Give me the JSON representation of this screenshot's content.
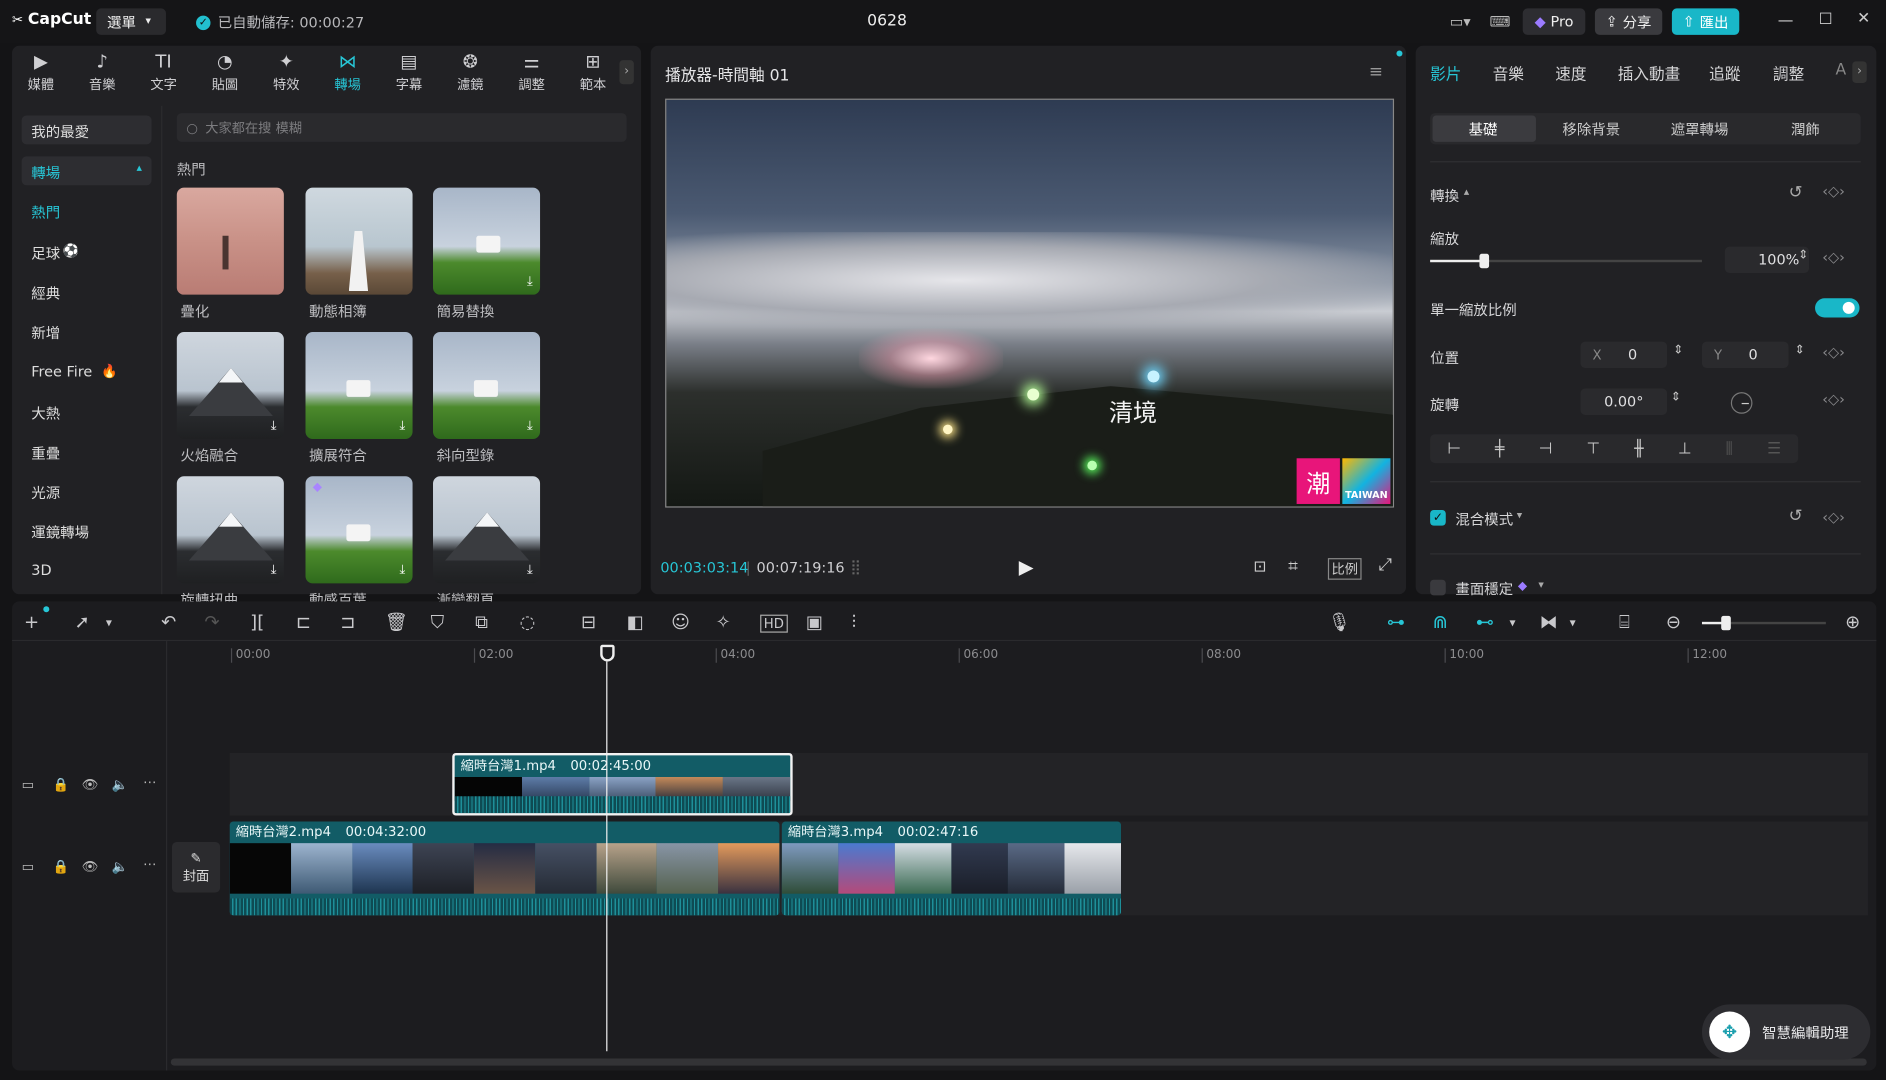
{
  "app": {
    "name": "CapCut",
    "menu_label": "選單",
    "autosave": "已自動儲存: 00:00:27",
    "project_title": "0628",
    "pro_label": "Pro",
    "share_label": "分享",
    "export_label": "匯出"
  },
  "left": {
    "tools": [
      {
        "label": "媒體",
        "icon": "▶"
      },
      {
        "label": "音樂",
        "icon": "♪"
      },
      {
        "label": "文字",
        "icon": "TI"
      },
      {
        "label": "貼圖",
        "icon": "◔"
      },
      {
        "label": "特效",
        "icon": "✦"
      },
      {
        "label": "轉場",
        "icon": "⋈"
      },
      {
        "label": "字幕",
        "icon": "▤"
      },
      {
        "label": "濾鏡",
        "icon": "❂"
      },
      {
        "label": "調整",
        "icon": "⚌"
      },
      {
        "label": "範本",
        "icon": "⊞"
      }
    ],
    "categories": [
      "我的最愛",
      "轉場",
      "熱門",
      "足球",
      "經典",
      "新增",
      "Free Fire",
      "大熱",
      "重疊",
      "光源",
      "運鏡轉場",
      "3D"
    ],
    "search_placeholder": "大家都在搜 模糊",
    "section_title": "熱門",
    "items": [
      {
        "label": "疊化"
      },
      {
        "label": "動態相簿"
      },
      {
        "label": "簡易替換"
      },
      {
        "label": "火焰融合"
      },
      {
        "label": "擴展符合"
      },
      {
        "label": "斜向型錄"
      },
      {
        "label": "旋轉扭曲"
      },
      {
        "label": "動感百葉"
      },
      {
        "label": "漸變翻頁"
      }
    ]
  },
  "player": {
    "title": "播放器-時間軸 01",
    "current_time": "00:03:03:14",
    "total_time": "00:07:19:16",
    "watermark_text": "清境",
    "logo_text": "潮",
    "logo_text2": "TAIWAN",
    "ratio_label": "比例"
  },
  "right": {
    "tabs": [
      "影片",
      "音樂",
      "速度",
      "插入動畫",
      "追蹤",
      "調整",
      "A"
    ],
    "subtabs": [
      "基礎",
      "移除背景",
      "遮罩轉場",
      "潤飾"
    ],
    "transform_label": "轉換",
    "scale_label": "縮放",
    "scale_value": "100%",
    "scale_level": 0.2,
    "uniform_label": "單一縮放比例",
    "position_label": "位置",
    "x_label": "X",
    "x_value": "0",
    "y_label": "Y",
    "y_value": "0",
    "rotate_label": "旋轉",
    "rotate_value": "0.00°",
    "blend_label": "混合模式",
    "stabilize_label": "畫面穩定"
  },
  "timeline": {
    "ruler": [
      "00:00",
      "02:00",
      "04:00",
      "06:00",
      "08:00",
      "10:00",
      "12:00"
    ],
    "clips": [
      {
        "name": "縮時台灣1.mp4",
        "duration": "00:02:45:00"
      },
      {
        "name": "縮時台灣2.mp4",
        "duration": "00:04:32:00"
      },
      {
        "name": "縮時台灣3.mp4",
        "duration": "00:02:47:16"
      }
    ],
    "cover_label": "封面",
    "assistant_label": "智慧編輯助理"
  },
  "colors": {
    "accent": "#27c6d6",
    "clip": "#125c66",
    "bg": "#141416",
    "panel": "#212124"
  }
}
